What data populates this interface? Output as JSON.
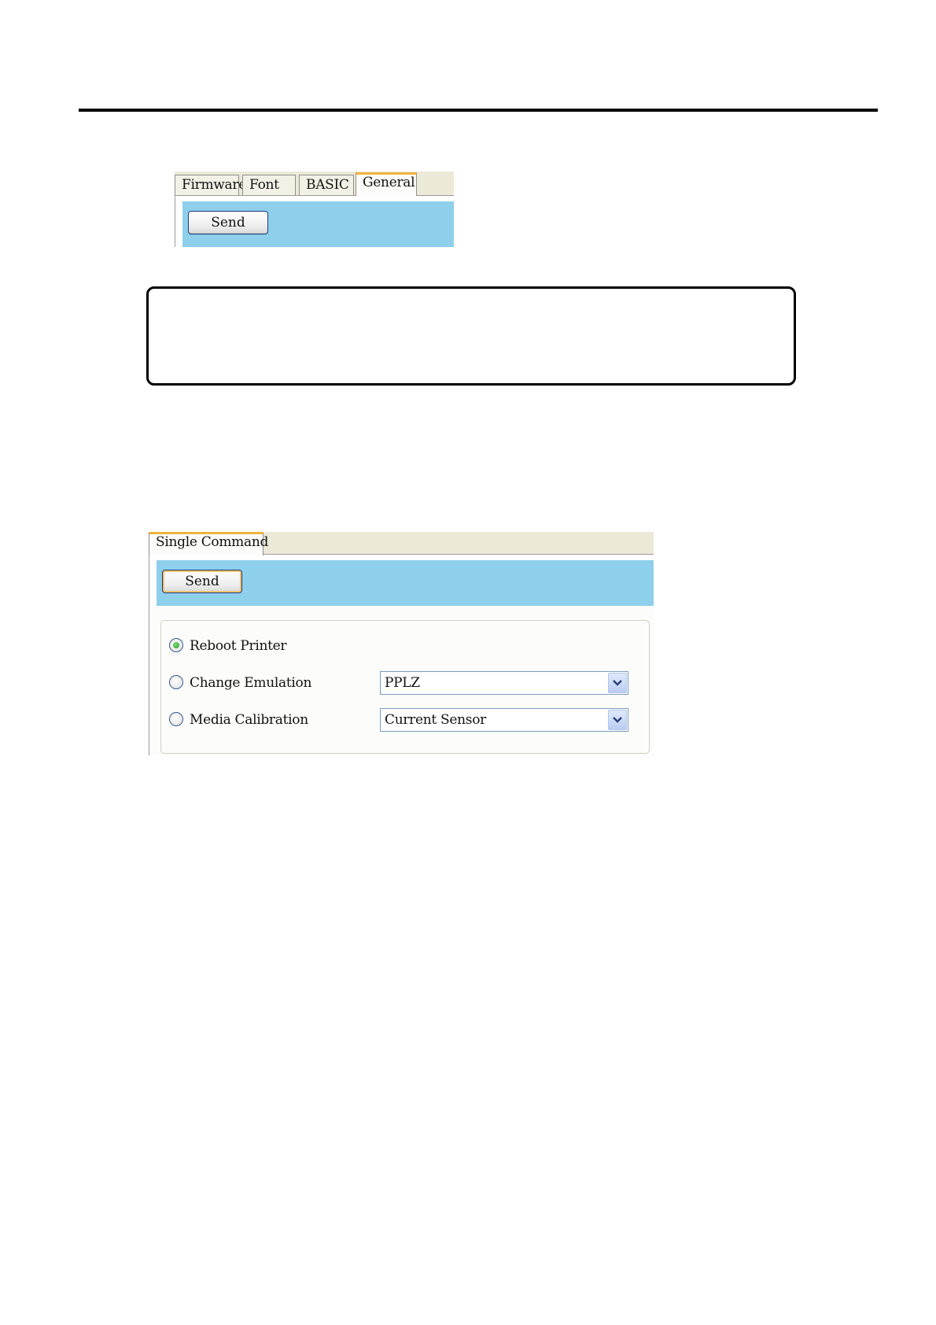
{
  "screenshot_general": {
    "tabs": [
      {
        "label": "Firmware"
      },
      {
        "label": "Font"
      },
      {
        "label": "BASIC"
      },
      {
        "label": "General"
      }
    ],
    "active_tab": "General",
    "send_label": "Send"
  },
  "screenshot_single_command": {
    "tab_label": "Single Command",
    "send_label": "Send",
    "options": [
      {
        "label": "Reboot Printer",
        "selected": true
      },
      {
        "label": "Change Emulation",
        "selected": false,
        "dropdown_value": "PPLZ"
      },
      {
        "label": "Media Calibration",
        "selected": false,
        "dropdown_value": "Current Sensor"
      }
    ],
    "colors": {
      "pane_blue": "#8ecfeb",
      "tab_strip": "#ece9d8",
      "active_tab_accent": "#f0b43c",
      "radio_selected": "#1e9a1e"
    }
  }
}
